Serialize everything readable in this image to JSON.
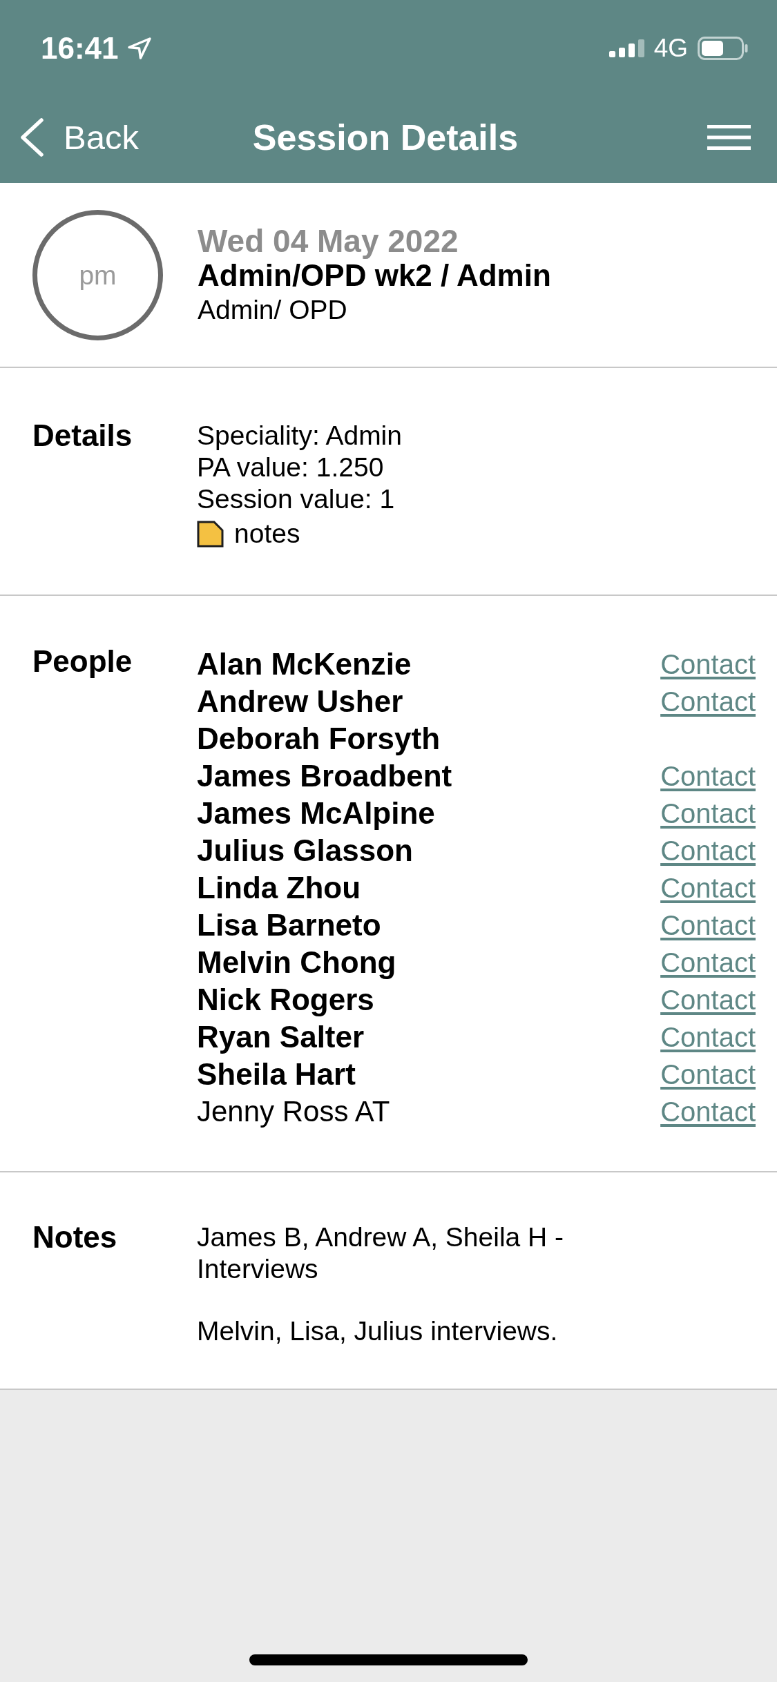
{
  "status_bar": {
    "time": "16:41",
    "network": "4G"
  },
  "nav": {
    "back": "Back",
    "title": "Session Details"
  },
  "session": {
    "period": "pm",
    "date": "Wed 04 May 2022",
    "title": "Admin/OPD wk2 / Admin",
    "subtitle": "Admin/ OPD"
  },
  "details": {
    "label": "Details",
    "lines": [
      "Speciality: Admin",
      "PA value: 1.250",
      "Session value: 1"
    ],
    "notes_link": "notes"
  },
  "people": {
    "label": "People",
    "items": [
      {
        "name": "Alan McKenzie",
        "bold": true,
        "contact": "Contact"
      },
      {
        "name": "Andrew Usher",
        "bold": true,
        "contact": "Contact"
      },
      {
        "name": "Deborah Forsyth",
        "bold": true
      },
      {
        "name": "James Broadbent",
        "bold": true,
        "contact": "Contact"
      },
      {
        "name": "James McAlpine",
        "bold": true,
        "contact": "Contact"
      },
      {
        "name": "Julius Glasson",
        "bold": true,
        "contact": "Contact"
      },
      {
        "name": "Linda Zhou",
        "bold": true,
        "contact": "Contact"
      },
      {
        "name": "Lisa Barneto",
        "bold": true,
        "contact": "Contact"
      },
      {
        "name": "Melvin Chong",
        "bold": true,
        "contact": "Contact"
      },
      {
        "name": "Nick Rogers",
        "bold": true,
        "contact": "Contact"
      },
      {
        "name": "Ryan Salter",
        "bold": true,
        "contact": "Contact"
      },
      {
        "name": "Sheila Hart",
        "bold": true,
        "contact": "Contact"
      },
      {
        "name": "Jenny Ross AT",
        "bold": false,
        "contact": "Contact"
      }
    ]
  },
  "notes": {
    "label": "Notes",
    "paragraphs": [
      "James B, Andrew A, Sheila H - Interviews",
      "Melvin, Lisa, Julius interviews."
    ]
  }
}
